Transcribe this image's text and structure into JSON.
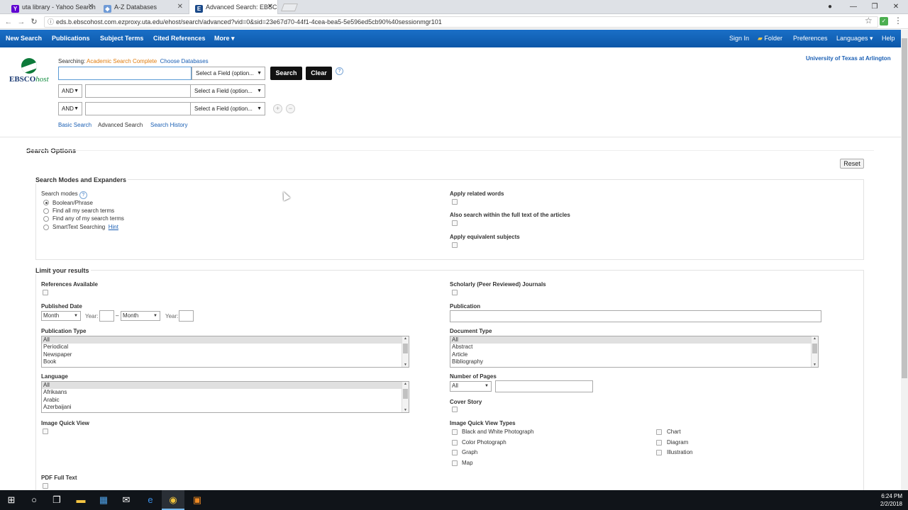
{
  "browser": {
    "tabs": [
      {
        "label": "uta library - Yahoo Search",
        "icon": "yahoo-icon"
      },
      {
        "label": "A-Z Databases",
        "icon": "libguides-icon"
      },
      {
        "label": "Advanced Search: EBSCO",
        "icon": "ebsco-icon"
      }
    ],
    "url": "eds.b.ebscohost.com.ezproxy.uta.edu/ehost/search/advanced?vid=0&sid=23e67d70-44f1-4cea-bea5-5e596ed5cb90%40sessionmgr101"
  },
  "topnav": {
    "left": [
      "New Search",
      "Publications",
      "Subject Terms",
      "Cited References",
      "More ▾"
    ],
    "right": [
      "Sign In",
      "Folder",
      "Preferences",
      "Languages ▾",
      "Help"
    ]
  },
  "logo": {
    "brand_a": "EBSCO",
    "brand_b": "host"
  },
  "search": {
    "searching_label": "Searching:",
    "database": "Academic Search Complete",
    "choose_db": "Choose Databases",
    "institution": "University of Texas at Arlington",
    "field_select": "Select a Field (option...",
    "bool_op": "AND",
    "search_btn": "Search",
    "clear_btn": "Clear",
    "row1_value": "",
    "row2_value": "",
    "row3_value": "",
    "links": [
      "Basic Search",
      "Advanced Search",
      "Search History"
    ]
  },
  "options": {
    "title": "Search Options",
    "reset": "Reset",
    "modes_section": "Search Modes and Expanders",
    "modes_label": "Search modes",
    "modes": [
      "Boolean/Phrase",
      "Find all my search terms",
      "Find any of my search terms",
      "SmartText Searching"
    ],
    "hint": "Hint",
    "selected_mode": 0,
    "expanders": [
      "Apply related words",
      "Also search within the full text of the articles",
      "Apply equivalent subjects"
    ]
  },
  "limits": {
    "title": "Limit your results",
    "references_available": "References Available",
    "published_date": "Published Date",
    "month": "Month",
    "year_label": "Year:",
    "dash": "–",
    "publication_type": "Publication Type",
    "publication_type_options": [
      "All",
      "Periodical",
      "Newspaper",
      "Book"
    ],
    "language": "Language",
    "language_options": [
      "All",
      "Afrikaans",
      "Arabic",
      "Azerbaijani"
    ],
    "image_quick_view": "Image Quick View",
    "pdf_full_text": "PDF Full Text",
    "scholarly": "Scholarly (Peer Reviewed) Journals",
    "publication": "Publication",
    "document_type": "Document Type",
    "document_type_options": [
      "All",
      "Abstract",
      "Article",
      "Bibliography"
    ],
    "number_of_pages": "Number of Pages",
    "pages_select": "All",
    "cover_story": "Cover Story",
    "image_types_label": "Image Quick View Types",
    "image_types_left": [
      "Black and White Photograph",
      "Color Photograph",
      "Graph",
      "Map"
    ],
    "image_types_right": [
      "Chart",
      "Diagram",
      "Illustration"
    ]
  },
  "taskbar": {
    "time": "6:24 PM",
    "date": "2/2/2018"
  }
}
